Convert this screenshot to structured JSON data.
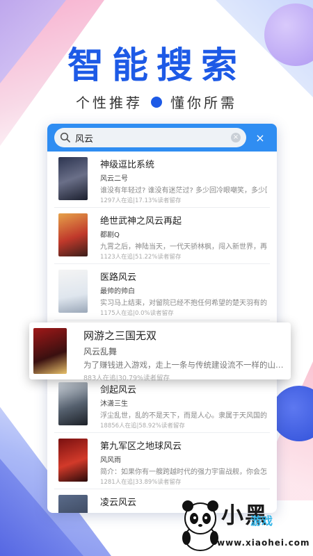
{
  "headline": "智能搜索",
  "tagline": {
    "left": "个性推荐",
    "right": "懂你所需"
  },
  "search": {
    "value": "风云",
    "close_label": "×",
    "clear_label": "×"
  },
  "books": [
    {
      "title": "神级逗比系统",
      "author": "风云二号",
      "desc": "谁没有年轻过? 谁没有迷茫过? 多少回冷眼嘲笑，多少回…",
      "stats": "1297人在追|17.13%读者留存"
    },
    {
      "title": "绝世武神之风云再起",
      "author": "都剧Q",
      "desc": "九霄之后，神陆当天，一代天骄林枫，闯入新世界，再度…",
      "stats": "1123人在追|51.22%读者留存"
    },
    {
      "title": "医路风云",
      "author": "最帅的帅白",
      "desc": "实习马上结束，对留院已经不抱任何希望的楚天羽有的…",
      "stats": "1175人在追|0.0%读者留存"
    },
    {
      "title": "剑起风云",
      "author": "沐潇三生",
      "desc": "浮尘乱世，乱的不是天下，而是人心。隶属于天风国的…",
      "stats": "18856人在追|58.92%读者留存"
    },
    {
      "title": "第九军区之地球风云",
      "author": "风风雨",
      "desc": "简介：如果你有一艘跨越时代的强力宇宙战舰，你会怎…",
      "stats": "1281人在追|33.89%读者留存"
    },
    {
      "title": "凌云风云",
      "author": "",
      "desc": "",
      "stats": ""
    }
  ],
  "featured": {
    "title": "网游之三国无双",
    "author": "风云乱舞",
    "desc": "为了赚钱进入游戏，走上一条与传统建设流不一样的山…",
    "stats": "883人在追|30.79%读者留存"
  },
  "brand": {
    "name": "小黑",
    "sub": "游戏",
    "url": "www.xiaohei.com"
  },
  "colors": {
    "accent": "#1d5ae6",
    "search_bar": "#2f8df2"
  }
}
